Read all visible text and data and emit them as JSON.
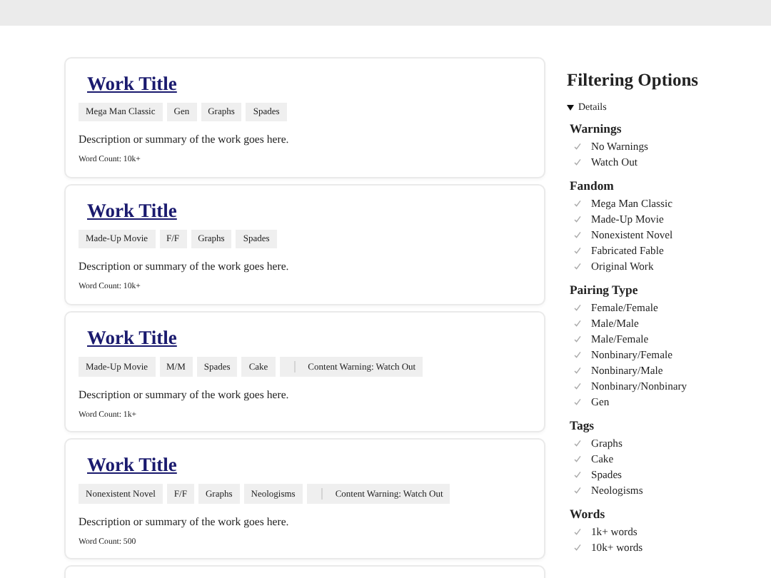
{
  "works": [
    {
      "title": "Work Title",
      "tags": [
        {
          "kind": "tag",
          "text": "Mega Man Classic"
        },
        {
          "kind": "tag",
          "text": "Gen"
        },
        {
          "kind": "tag",
          "text": "Graphs"
        },
        {
          "kind": "tag",
          "text": "Spades"
        }
      ],
      "summary": "Description or summary of the work goes here.",
      "word_count": "Word Count: 10k+"
    },
    {
      "title": "Work Title",
      "tags": [
        {
          "kind": "tag",
          "text": "Made-Up Movie"
        },
        {
          "kind": "tag",
          "text": "F/F"
        },
        {
          "kind": "tag",
          "text": "Graphs"
        },
        {
          "kind": "tag",
          "text": "Spades"
        }
      ],
      "summary": "Description or summary of the work goes here.",
      "word_count": "Word Count: 10k+"
    },
    {
      "title": "Work Title",
      "tags": [
        {
          "kind": "tag",
          "text": "Made-Up Movie"
        },
        {
          "kind": "tag",
          "text": "M/M"
        },
        {
          "kind": "tag",
          "text": "Spades"
        },
        {
          "kind": "tag",
          "text": "Cake"
        },
        {
          "kind": "warning",
          "text": "Content Warning: Watch Out"
        }
      ],
      "summary": "Description or summary of the work goes here.",
      "word_count": "Word Count: 1k+"
    },
    {
      "title": "Work Title",
      "tags": [
        {
          "kind": "tag",
          "text": "Nonexistent Novel"
        },
        {
          "kind": "tag",
          "text": "F/F"
        },
        {
          "kind": "tag",
          "text": "Graphs"
        },
        {
          "kind": "tag",
          "text": "Neologisms"
        },
        {
          "kind": "warning",
          "text": "Content Warning: Watch Out"
        }
      ],
      "summary": "Description or summary of the work goes here.",
      "word_count": "Word Count: 500"
    }
  ],
  "sidebar": {
    "title": "Filtering Options",
    "details": {
      "summary": "Details",
      "expanded": true
    },
    "sections": [
      {
        "heading": "Warnings",
        "items": [
          "No Warnings",
          "Watch Out"
        ]
      },
      {
        "heading": "Fandom",
        "items": [
          "Mega Man Classic",
          "Made-Up Movie",
          "Nonexistent Novel",
          "Fabricated Fable",
          "Original Work"
        ]
      },
      {
        "heading": "Pairing Type",
        "items": [
          "Female/Female",
          "Male/Male",
          "Male/Female",
          "Nonbinary/Female",
          "Nonbinary/Male",
          "Nonbinary/Nonbinary",
          "Gen"
        ]
      },
      {
        "heading": "Tags",
        "items": [
          "Graphs",
          "Cake",
          "Spades",
          "Neologisms"
        ]
      },
      {
        "heading": "Words",
        "items": [
          "1k+ words",
          "10k+ words"
        ]
      }
    ]
  }
}
